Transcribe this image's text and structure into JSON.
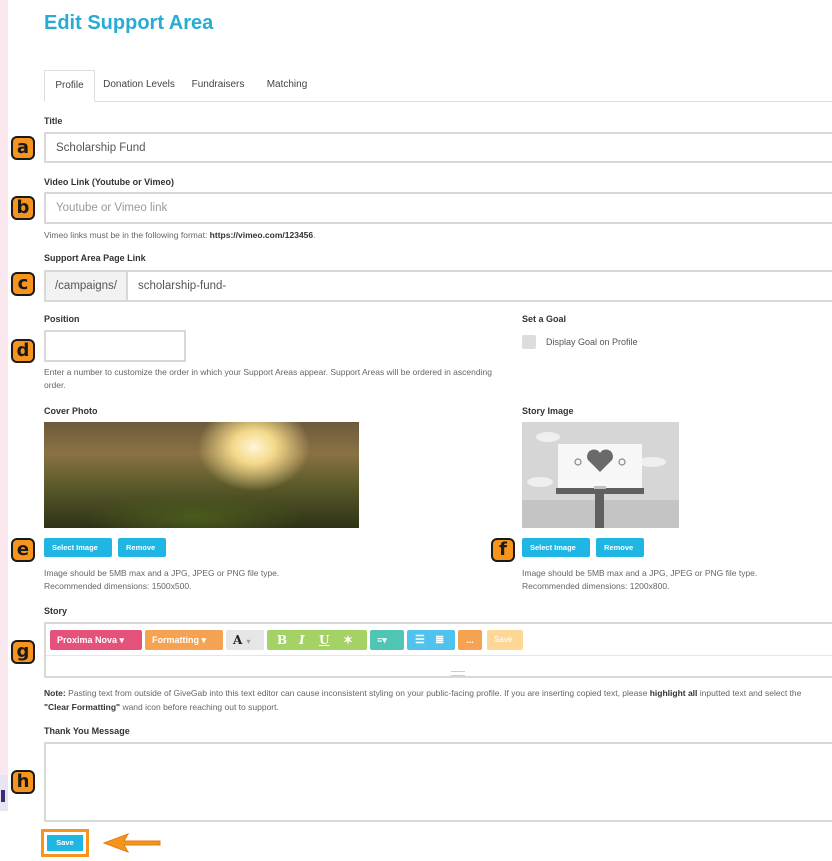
{
  "page": {
    "title": "Edit Support Area"
  },
  "tabs": [
    {
      "label": "Profile",
      "active": true
    },
    {
      "label": "Donation Levels"
    },
    {
      "label": "Fundraisers"
    },
    {
      "label": "Matching"
    }
  ],
  "callouts": [
    "a",
    "b",
    "c",
    "d",
    "e",
    "f",
    "g",
    "h"
  ],
  "fields": {
    "title": {
      "label": "Title",
      "value": "Scholarship Fund"
    },
    "video": {
      "label": "Video Link (Youtube or Vimeo)",
      "placeholder": "Youtube or Vimeo link",
      "help_prefix": "Vimeo links must be in the following format: ",
      "help_example": "https://vimeo.com/123456",
      "help_suffix": "."
    },
    "page_link": {
      "label": "Support Area Page Link",
      "prefix": "/campaigns/",
      "value": "scholarship-fund-"
    },
    "position": {
      "label": "Position",
      "value": "",
      "help": "Enter a number to customize the order in which your Support Areas appear. Support Areas will be ordered in ascending order."
    },
    "goal": {
      "label": "Set a Goal",
      "checkbox_label": "Display Goal on Profile",
      "checked": false
    }
  },
  "cover_photo": {
    "label": "Cover Photo",
    "select_label": "Select Image",
    "remove_label": "Remove",
    "help_line1": "Image should be 5MB max and a JPG, JPEG or PNG file type.",
    "help_line2": "Recommended dimensions: 1500x500."
  },
  "story_image": {
    "label": "Story Image",
    "select_label": "Select Image",
    "remove_label": "Remove",
    "help_line1": "Image should be 5MB max and a JPG, JPEG or PNG file type.",
    "help_line2": "Recommended dimensions: 1200x800."
  },
  "story": {
    "label": "Story",
    "toolbar": {
      "font": "Proxima Nova ▾",
      "formatting": "Formatting ▾",
      "color_glyph": "A",
      "dropdown_glyph": "▾",
      "bold": "B",
      "italic": "I",
      "underline": "U",
      "clear_glyph": "✶",
      "align_glyph": "≡▾",
      "ul_glyph": "☰",
      "ol_glyph": "≣",
      "more_glyph": "...",
      "save": "Save"
    },
    "note_bold": "Note:",
    "note_part1": " Pasting text from outside of GiveGab into this text editor can cause inconsistent styling on your public-facing profile. If you are inserting copied text, please ",
    "note_highlight": "highlight all",
    "note_part2": " inputted text and select the ",
    "note_clear": "\"Clear Formatting\"",
    "note_part3": " wand icon before reaching out to support."
  },
  "thank_you": {
    "label": "Thank You Message",
    "value": ""
  },
  "save_label": "Save",
  "colors": {
    "accent": "#29abd4",
    "button": "#1fb6e3",
    "callout": "#f7941d",
    "font_btn": "#e4517b",
    "formatting_btn": "#f5a253",
    "text_style_btn": "#a4d266",
    "align_btn": "#4fc6b3",
    "list_btn": "#4fc3ee",
    "save_tool": "#ffd794"
  }
}
